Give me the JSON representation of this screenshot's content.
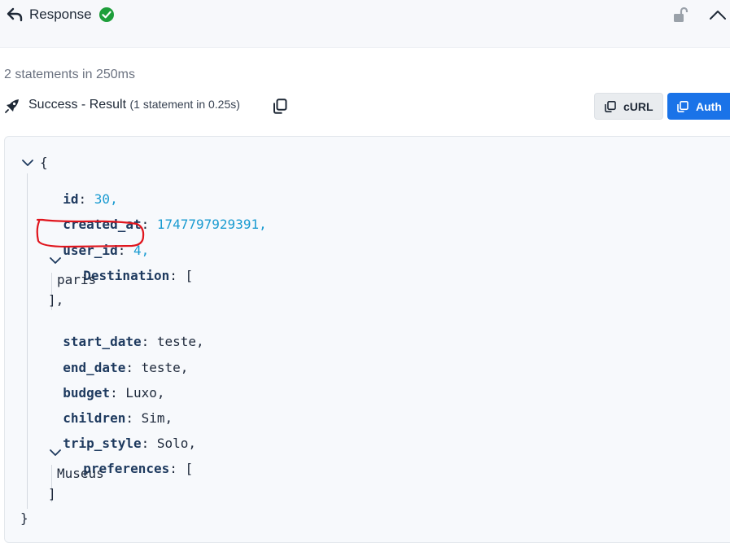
{
  "header": {
    "title": "Response"
  },
  "summary": "2 statements in 250ms",
  "result": {
    "label": "Success - Result",
    "detail": "(1 statement in 0.25s)"
  },
  "buttons": {
    "curl": "cURL",
    "auth": "Auth"
  },
  "json": {
    "open_brace": "{",
    "close_brace": "}",
    "fields": [
      {
        "key": "id",
        "value": "30,"
      },
      {
        "key": "created_at",
        "value": "1747797929391,"
      },
      {
        "key": "user_id",
        "value": "4,"
      },
      {
        "key": "Destination",
        "value": "["
      },
      {
        "key": "start_date",
        "value": "teste,"
      },
      {
        "key": "end_date",
        "value": "teste,"
      },
      {
        "key": "budget",
        "value": "Luxo,"
      },
      {
        "key": "children",
        "value": "Sim,"
      },
      {
        "key": "trip_style",
        "value": "Solo,"
      },
      {
        "key": "preferences",
        "value": "["
      }
    ],
    "destination_items": [
      "paris"
    ],
    "destination_close": "],",
    "preferences_items": [
      "Museus"
    ],
    "preferences_close": "]"
  },
  "colors": {
    "accent": "#1a73e8",
    "success": "#1e9e3a",
    "number": "#1a9bd1",
    "annotation": "#e0151d"
  },
  "icons": [
    "back-arrow-icon",
    "check-circle-icon",
    "lock-open-icon",
    "chevron-up-icon",
    "rocket-icon",
    "copy-icon",
    "chevron-down-icon"
  ]
}
